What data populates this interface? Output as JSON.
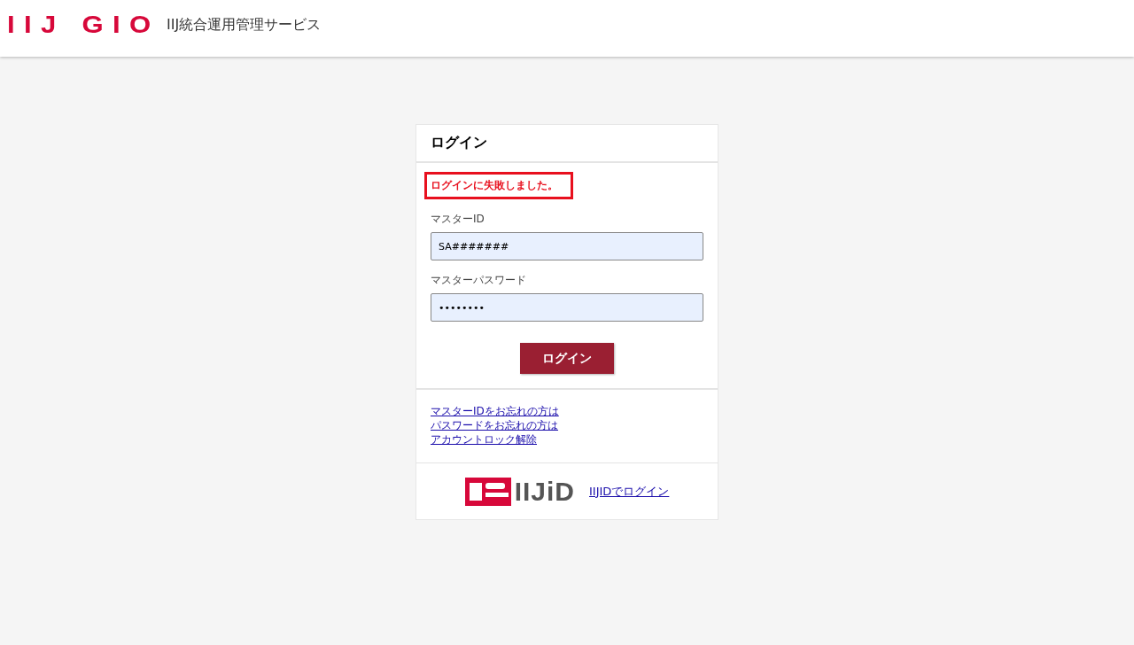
{
  "header": {
    "logo": "IIJ GIO",
    "service_name": "IIJ統合運用管理サービス"
  },
  "login_panel": {
    "title": "ログイン",
    "error": "ログインに失敗しました。",
    "fields": [
      {
        "label": "マスターID",
        "value": "SA#######"
      },
      {
        "label": "マスターパスワード",
        "value": "••••••••"
      }
    ],
    "submit": "ログイン",
    "links": [
      "マスターIDをお忘れの方は",
      "パスワードをお忘れの方は",
      "アカウントロック解除"
    ],
    "iijid": {
      "logo": "IIJiD",
      "link": "IIJIDでログイン"
    }
  }
}
